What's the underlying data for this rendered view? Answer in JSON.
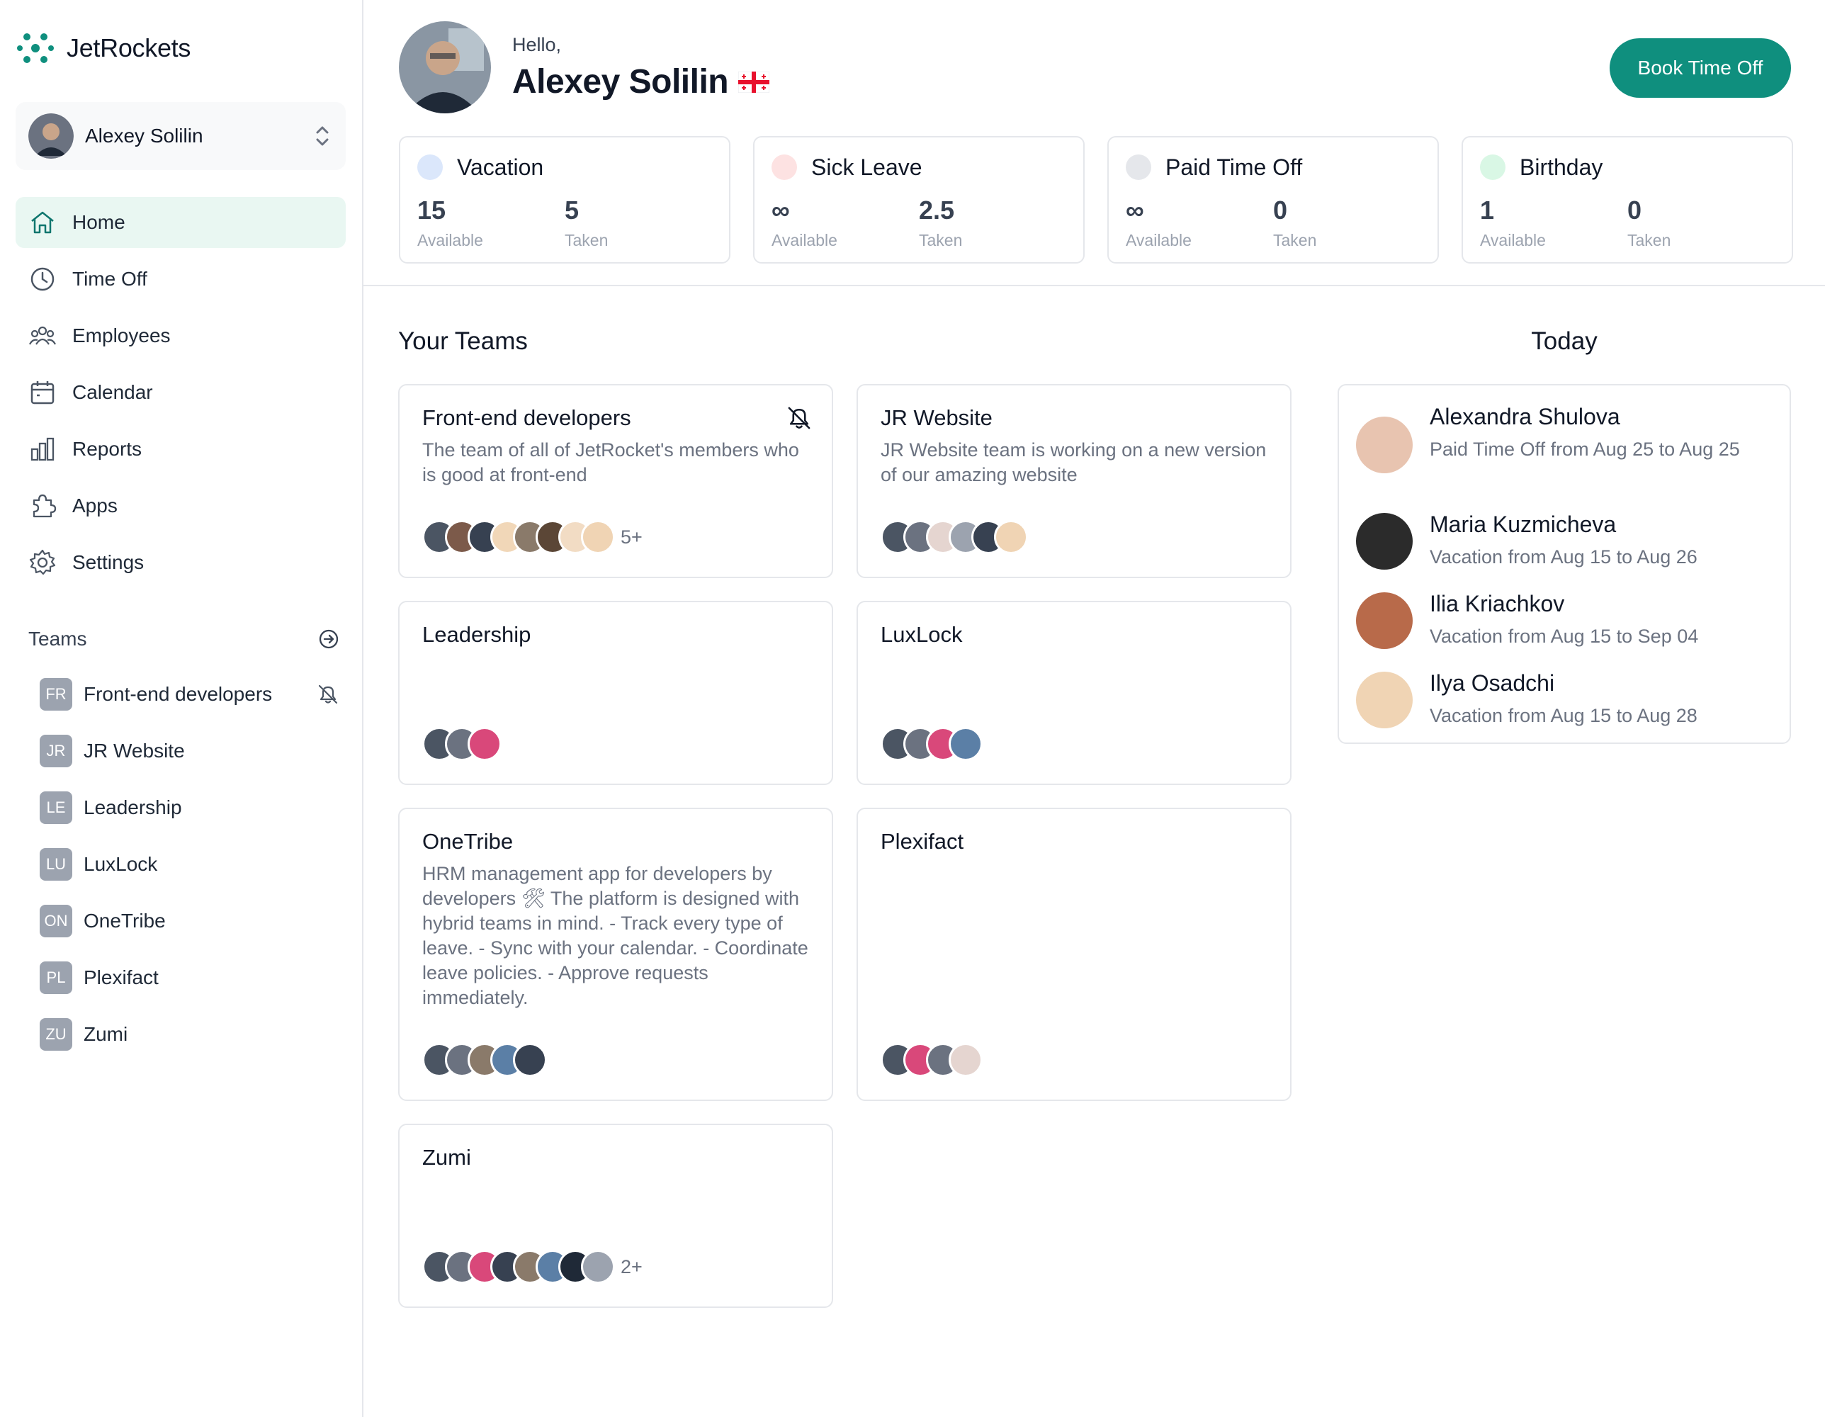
{
  "brand": {
    "name": "JetRockets",
    "color": "#0f8f7e"
  },
  "current_user": {
    "name": "Alexey Solilin"
  },
  "nav": [
    {
      "label": "Home",
      "icon": "home-icon",
      "active": true
    },
    {
      "label": "Time Off",
      "icon": "clock-icon",
      "active": false
    },
    {
      "label": "Employees",
      "icon": "users-icon",
      "active": false
    },
    {
      "label": "Calendar",
      "icon": "calendar-icon",
      "active": false
    },
    {
      "label": "Reports",
      "icon": "bar-chart-icon",
      "active": false
    },
    {
      "label": "Apps",
      "icon": "puzzle-icon",
      "active": false
    },
    {
      "label": "Settings",
      "icon": "gear-icon",
      "active": false
    }
  ],
  "teams_section": {
    "label": "Teams"
  },
  "teams": [
    {
      "badge": "FR",
      "name": "Front-end developers",
      "muted": true
    },
    {
      "badge": "JR",
      "name": "JR Website",
      "muted": false
    },
    {
      "badge": "LE",
      "name": "Leadership",
      "muted": false
    },
    {
      "badge": "LU",
      "name": "LuxLock",
      "muted": false
    },
    {
      "badge": "ON",
      "name": "OneTribe",
      "muted": false
    },
    {
      "badge": "PL",
      "name": "Plexifact",
      "muted": false
    },
    {
      "badge": "ZU",
      "name": "Zumi",
      "muted": false
    }
  ],
  "header": {
    "greeting": "Hello,",
    "name": "Alexey Solilin",
    "book_button": "Book Time Off"
  },
  "stats": [
    {
      "title": "Vacation",
      "dot_color": "#dbe7fb",
      "available": "15",
      "taken": "5",
      "available_label": "Available",
      "taken_label": "Taken"
    },
    {
      "title": "Sick Leave",
      "dot_color": "#fde2e2",
      "available": "∞",
      "taken": "2.5",
      "available_label": "Available",
      "taken_label": "Taken"
    },
    {
      "title": "Paid Time Off",
      "dot_color": "#e5e7eb",
      "available": "∞",
      "taken": "0",
      "available_label": "Available",
      "taken_label": "Taken"
    },
    {
      "title": "Birthday",
      "dot_color": "#d9f7e5",
      "available": "1",
      "taken": "0",
      "available_label": "Available",
      "taken_label": "Taken"
    }
  ],
  "main": {
    "your_teams": "Your Teams",
    "today": "Today"
  },
  "team_cards": [
    {
      "name": "Front-end developers",
      "desc": "The team of all of JetRocket's members who is good at front-end",
      "muted": true,
      "avatars": [
        "#4b5563",
        "#7c5a4a",
        "#374151",
        "#f1d7b8",
        "#8a7a6a",
        "#5b4636",
        "#f2dcc4",
        "#f0d4b4"
      ],
      "more": "5+"
    },
    {
      "name": "JR Website",
      "desc": "JR Website team is working on a new version of our amazing website",
      "muted": false,
      "avatars": [
        "#4b5563",
        "#6b7280",
        "#e5d5d0",
        "#9ca3af",
        "#374151",
        "#f0d4b4"
      ],
      "more": ""
    },
    {
      "name": "Leadership",
      "desc": "",
      "muted": false,
      "avatars": [
        "#4b5563",
        "#6b7280",
        "#d9487a"
      ],
      "more": ""
    },
    {
      "name": "LuxLock",
      "desc": "",
      "muted": false,
      "avatars": [
        "#4b5563",
        "#6b7280",
        "#d9487a",
        "#5b7fa6"
      ],
      "more": ""
    },
    {
      "name": "OneTribe",
      "desc": "HRM management app for developers by developers 🛠 The platform is designed with hybrid teams in mind. - Track every type of leave. - Sync with your calendar. - Coordinate leave policies. - Approve requests immediately.",
      "muted": false,
      "avatars": [
        "#4b5563",
        "#6b7280",
        "#8a7a6a",
        "#5b7fa6",
        "#374151"
      ],
      "more": ""
    },
    {
      "name": "Plexifact",
      "desc": "",
      "muted": false,
      "avatars": [
        "#4b5563",
        "#d9487a",
        "#6b7280",
        "#e5d5d0"
      ],
      "more": ""
    },
    {
      "name": "Zumi",
      "desc": "",
      "muted": false,
      "avatars": [
        "#4b5563",
        "#6b7280",
        "#d9487a",
        "#374151",
        "#8a7a6a",
        "#5b7fa6",
        "#1f2937",
        "#9ca3af"
      ],
      "more": "2+"
    }
  ],
  "today": [
    {
      "name": "Alexandra Shulova",
      "detail": "Paid Time Off from Aug 25 to Aug 25",
      "avatar": "#e8c4b0"
    },
    {
      "name": "Maria Kuzmicheva",
      "detail": "Vacation from Aug 15 to Aug 26",
      "avatar": "#2b2b2b"
    },
    {
      "name": "Ilia Kriachkov",
      "detail": "Vacation from Aug 15 to Sep 04",
      "avatar": "#b86a4a"
    },
    {
      "name": "Ilya Osadchi",
      "detail": "Vacation from Aug 15 to Aug 28",
      "avatar": "#f0d4b4"
    }
  ]
}
